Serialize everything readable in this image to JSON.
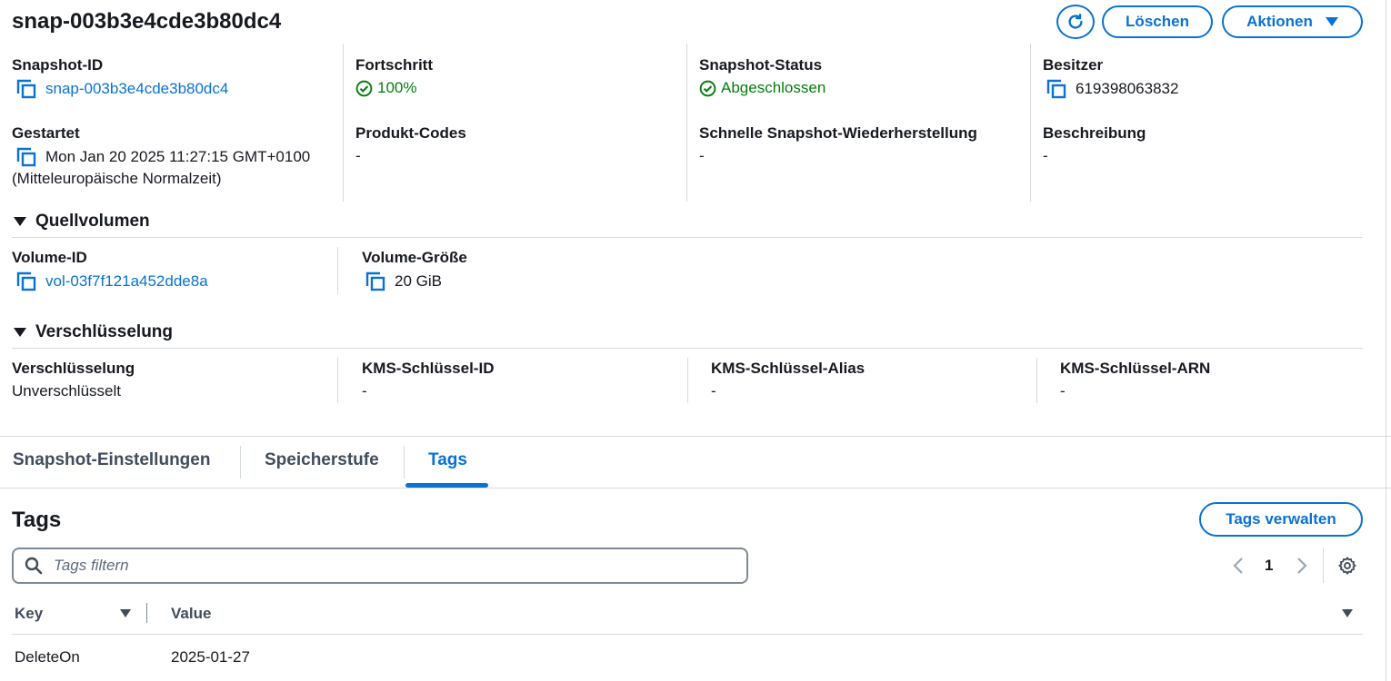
{
  "header": {
    "title": "snap-003b3e4cde3b80dc4",
    "delete_label": "Löschen",
    "actions_label": "Aktionen"
  },
  "details": {
    "snapshot_id_label": "Snapshot-ID",
    "snapshot_id": "snap-003b3e4cde3b80dc4",
    "progress_label": "Fortschritt",
    "progress": "100%",
    "status_label": "Snapshot-Status",
    "status": "Abgeschlossen",
    "owner_label": "Besitzer",
    "owner": "619398063832",
    "started_label": "Gestartet",
    "started_line1": "Mon Jan 20 2025 11:27:15 GMT+0100",
    "started_line2": "(Mitteleuropäische Normalzeit)",
    "product_codes_label": "Produkt-Codes",
    "product_codes": "-",
    "fast_restore_label": "Schnelle Snapshot-Wiederherstellung",
    "fast_restore": "-",
    "description_label": "Beschreibung",
    "description": "-"
  },
  "source_volume": {
    "heading": "Quellvolumen",
    "volume_id_label": "Volume-ID",
    "volume_id": "vol-03f7f121a452dde8a",
    "volume_size_label": "Volume-Größe",
    "volume_size": "20 GiB"
  },
  "encryption": {
    "heading": "Verschlüsselung",
    "encryption_label": "Verschlüsselung",
    "encryption_value": "Unverschlüsselt",
    "kms_key_id_label": "KMS-Schlüssel-ID",
    "kms_key_id": "-",
    "kms_key_alias_label": "KMS-Schlüssel-Alias",
    "kms_key_alias": "-",
    "kms_key_arn_label": "KMS-Schlüssel-ARN",
    "kms_key_arn": "-"
  },
  "tabs": [
    {
      "label": "Snapshot-Einstellungen",
      "active": false
    },
    {
      "label": "Speicherstufe",
      "active": false
    },
    {
      "label": "Tags",
      "active": true
    }
  ],
  "tags_panel": {
    "heading": "Tags",
    "manage_label": "Tags verwalten",
    "filter_placeholder": "Tags filtern",
    "page_number": "1",
    "columns": [
      "Key",
      "Value"
    ],
    "rows": [
      {
        "key": "DeleteOn",
        "value": "2025-01-27"
      }
    ]
  },
  "colors": {
    "link": "#0972d3",
    "success": "#037f0c",
    "text": "#16191f",
    "divider": "#d5dbdb"
  }
}
